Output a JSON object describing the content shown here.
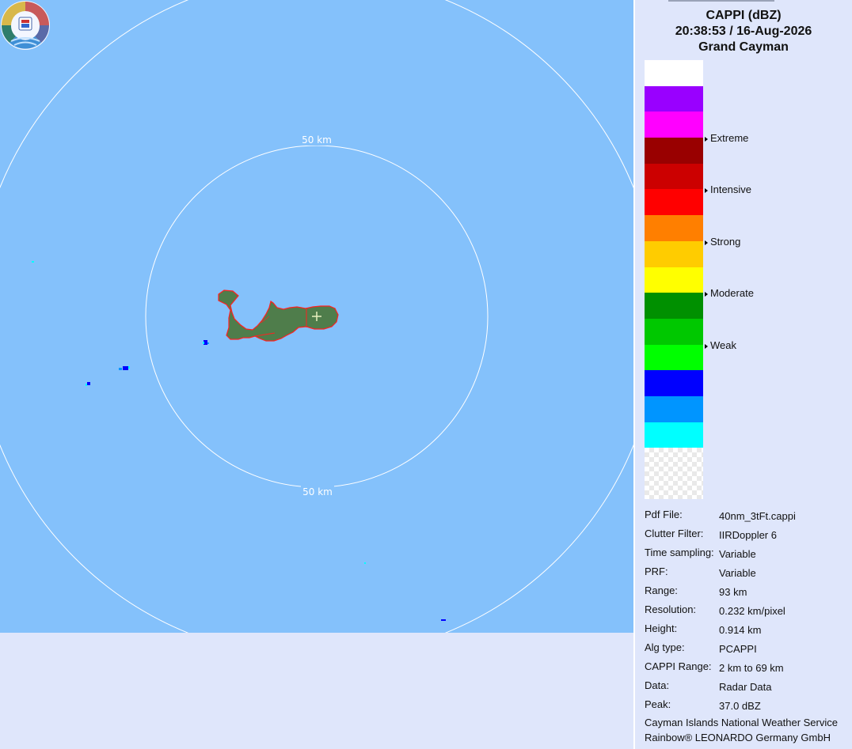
{
  "map": {
    "ring_labels": [
      "50 km",
      "50 km"
    ],
    "background_color": "#84c1fb",
    "ring_color": "#ffffff",
    "land_fill": "#4f7d4b",
    "coast_color": "#ff2020",
    "logo": "cayman-weather-service-logo"
  },
  "header": {
    "product": "CAPPI (dBZ)",
    "datetime": "20:38:53 / 16-Aug-2026",
    "site": "Grand Cayman"
  },
  "legend": {
    "colors": [
      "#ffffff",
      "#9900ff",
      "#ff00ff",
      "#990000",
      "#cc0000",
      "#ff0000",
      "#ff7f00",
      "#ffcc00",
      "#ffff00",
      "#009000",
      "#00c800",
      "#00ff00",
      "#0000ff",
      "#0095ff",
      "#00ffff"
    ],
    "levels": [
      "Extreme",
      "Intensive",
      "Strong",
      "Moderate",
      "Weak"
    ]
  },
  "info": [
    {
      "key": "Pdf File:",
      "value": "40nm_3tFt.cappi"
    },
    {
      "key": "Clutter Filter:",
      "value": "IIRDoppler 6"
    },
    {
      "key": "Time sampling:",
      "value": "Variable"
    },
    {
      "key": "PRF:",
      "value": "Variable"
    },
    {
      "key": "Range:",
      "value": "93 km"
    },
    {
      "key": "Resolution:",
      "value": "0.232 km/pixel"
    },
    {
      "key": "Height:",
      "value": "0.914 km"
    },
    {
      "key": "Alg type:",
      "value": "PCAPPI"
    },
    {
      "key": "CAPPI Range:",
      "value": "2 km to 69 km"
    },
    {
      "key": "Data:",
      "value": "Radar Data"
    },
    {
      "key": "Peak:",
      "value": "37.0 dBZ"
    }
  ],
  "footer": {
    "line1": "Cayman Islands National Weather Service",
    "line2": "Rainbow® LEONARDO Germany GmbH"
  }
}
